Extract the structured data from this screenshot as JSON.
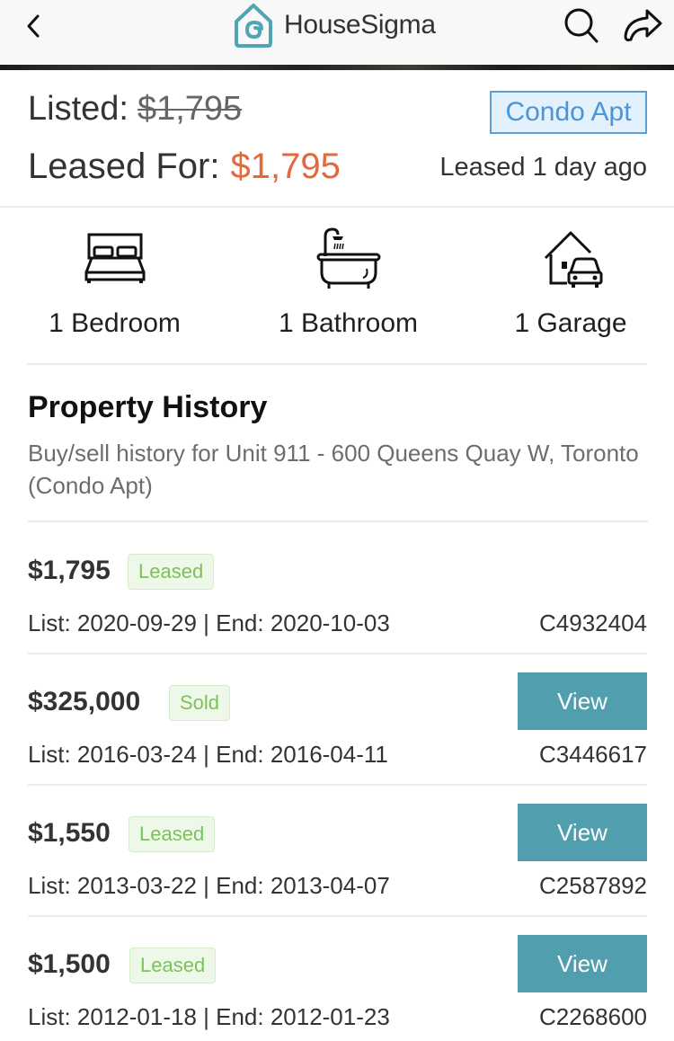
{
  "header": {
    "back_icon": "chevron-left-icon",
    "logo_icon": "housesigma-logo-icon",
    "brand_name": "HouseSigma",
    "search_icon": "search-icon",
    "share_icon": "share-icon"
  },
  "listing": {
    "listed_label": "Listed:",
    "listed_price": "$1,795",
    "leased_label": "Leased For:",
    "leased_price": "$1,795",
    "property_type": "Condo Apt",
    "leased_ago": "Leased 1 day ago",
    "colors": {
      "leased_price": "#e4683c",
      "type_badge_text": "#4a94d8",
      "type_badge_bg": "#e3f1fd"
    }
  },
  "features": [
    {
      "icon": "bed-icon",
      "label": "1 Bedroom"
    },
    {
      "icon": "bathtub-icon",
      "label": "1 Bathroom"
    },
    {
      "icon": "garage-icon",
      "label": "1 Garage"
    }
  ],
  "history": {
    "title": "Property History",
    "subtitle": "Buy/sell history for Unit 911 - 600 Queens Quay W, Toronto (Condo Apt)",
    "view_label": "View",
    "colors": {
      "view_button": "#519fae",
      "status_text": "#7ec05c",
      "status_bg": "#eef8e8"
    },
    "records": [
      {
        "price": "$1,795",
        "status": "Leased",
        "dates": "List: 2020-09-29 | End: 2020-10-03",
        "mls": "C4932404",
        "has_view": false
      },
      {
        "price": "$325,000",
        "status": "Sold",
        "dates": "List: 2016-03-24 | End: 2016-04-11",
        "mls": "C3446617",
        "has_view": true
      },
      {
        "price": "$1,550",
        "status": "Leased",
        "dates": "List: 2013-03-22 | End: 2013-04-07",
        "mls": "C2587892",
        "has_view": true
      },
      {
        "price": "$1,500",
        "status": "Leased",
        "dates": "List: 2012-01-18 | End: 2012-01-23",
        "mls": "C2268600",
        "has_view": true
      }
    ]
  }
}
